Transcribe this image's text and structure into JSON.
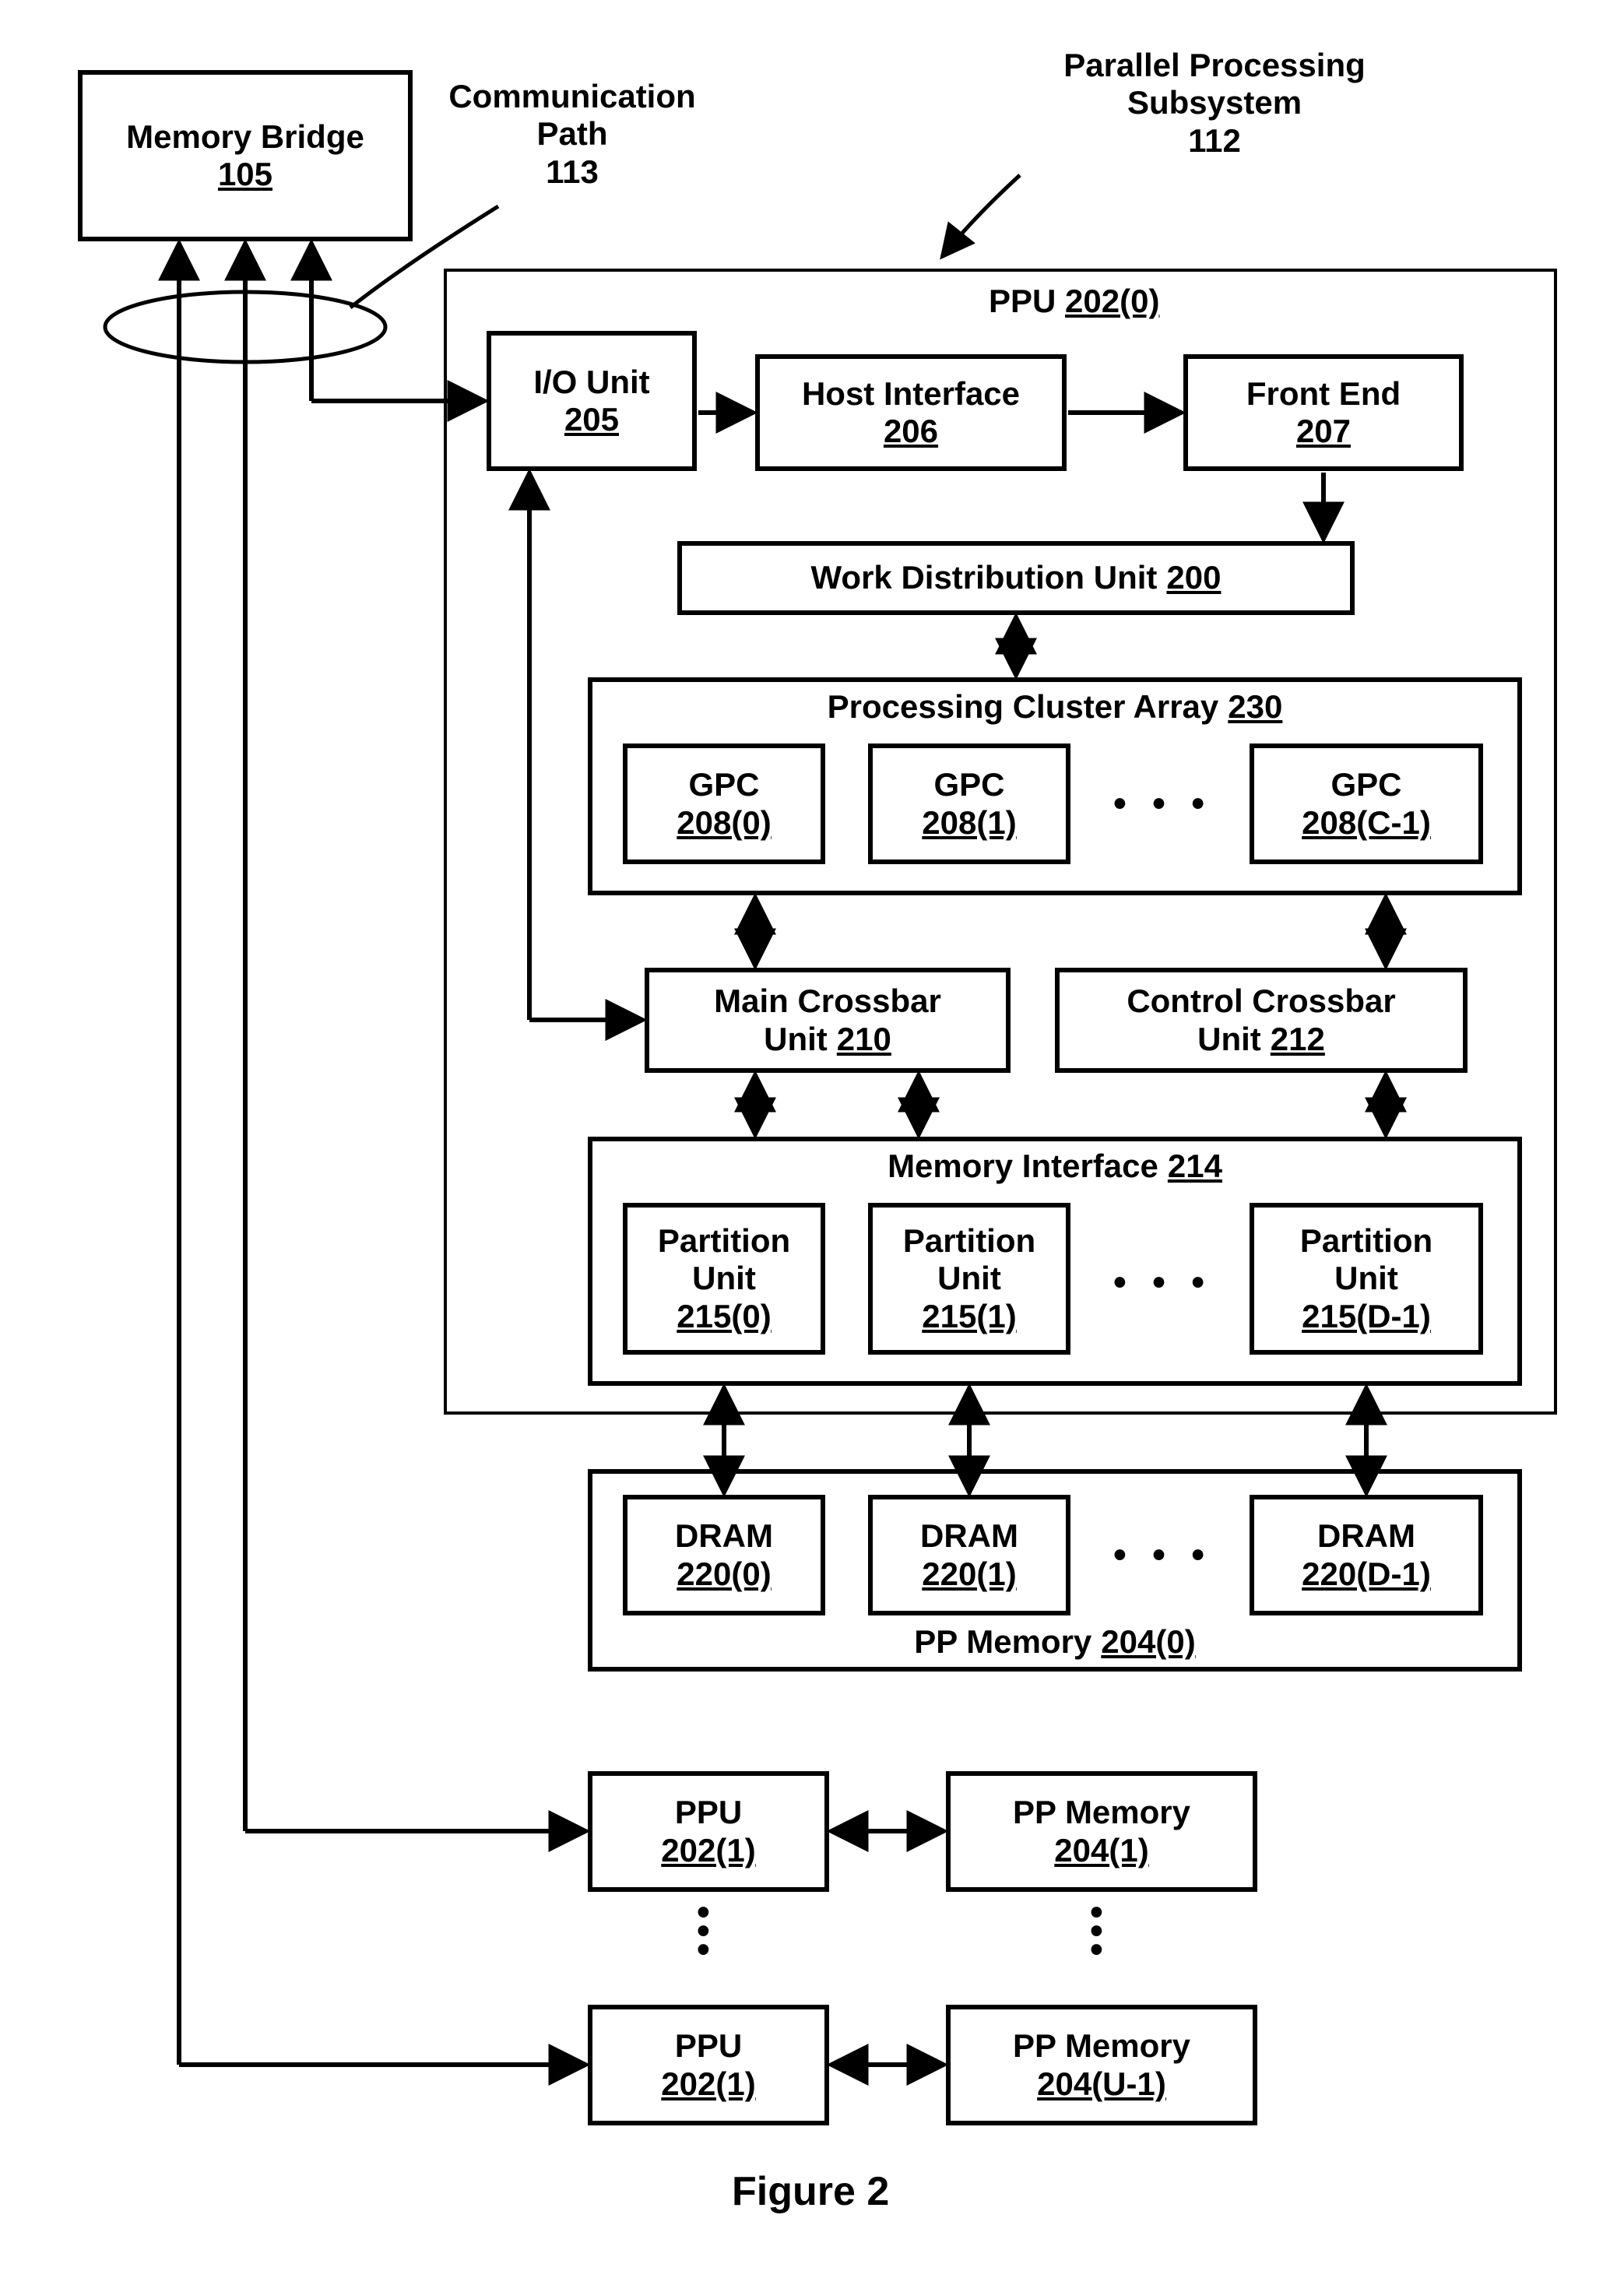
{
  "memoryBridge": {
    "title": "Memory Bridge",
    "num": "105"
  },
  "commPath": {
    "title": "Communication\nPath",
    "num": "113"
  },
  "pps": {
    "title": "Parallel Processing\nSubsystem",
    "num": "112"
  },
  "ppu0_label": {
    "title": "PPU",
    "num": "202(0)"
  },
  "ioUnit": {
    "title": "I/O Unit",
    "num": "205"
  },
  "hostIf": {
    "title": "Host Interface",
    "num": "206"
  },
  "frontEnd": {
    "title": "Front End",
    "num": "207"
  },
  "wdu": {
    "title": "Work Distribution Unit",
    "num": "200"
  },
  "pca": {
    "title": "Processing Cluster Array",
    "num": "230"
  },
  "gpc0": {
    "title": "GPC",
    "num": "208(0)"
  },
  "gpc1": {
    "title": "GPC",
    "num": "208(1)"
  },
  "gpcC": {
    "title": "GPC",
    "num": "208(C-1)"
  },
  "mainXbar": {
    "title": "Main Crossbar\nUnit",
    "num": "210"
  },
  "ctrlXbar": {
    "title": "Control Crossbar\nUnit",
    "num": "212"
  },
  "memIf": {
    "title": "Memory Interface",
    "num": "214"
  },
  "pu0": {
    "title": "Partition\nUnit",
    "num": "215(0)"
  },
  "pu1": {
    "title": "Partition\nUnit",
    "num": "215(1)"
  },
  "puD": {
    "title": "Partition\nUnit",
    "num": "215(D-1)"
  },
  "dram0": {
    "title": "DRAM",
    "num": "220(0)"
  },
  "dram1": {
    "title": "DRAM",
    "num": "220(1)"
  },
  "dramD": {
    "title": "DRAM",
    "num": "220(D-1)"
  },
  "ppMem0": {
    "title": "PP Memory",
    "num": "204(0)"
  },
  "ppu1": {
    "title": "PPU",
    "num": "202(1)"
  },
  "ppMem1": {
    "title": "PP Memory",
    "num": "204(1)"
  },
  "ppuU": {
    "title": "PPU",
    "num": "202(1)"
  },
  "ppMemU": {
    "title": "PP Memory",
    "num": "204(U-1)"
  },
  "figCaption": "Figure 2",
  "ellipsis": "• • •",
  "vdot": "•\n•\n•"
}
